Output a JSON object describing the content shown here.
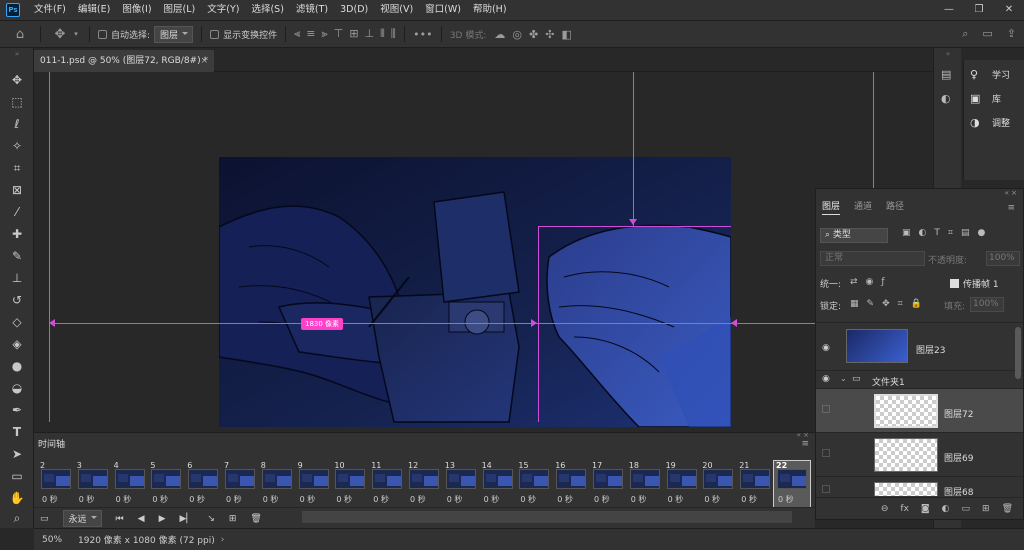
{
  "app": {
    "logo": "Ps"
  },
  "menu": [
    "文件(F)",
    "编辑(E)",
    "图像(I)",
    "图层(L)",
    "文字(Y)",
    "选择(S)",
    "滤镜(T)",
    "3D(D)",
    "视图(V)",
    "窗口(W)",
    "帮助(H)"
  ],
  "window_controls": {
    "minimize": "—",
    "restore": "❐",
    "close": "✕"
  },
  "options": {
    "auto_select_label": "自动选择:",
    "auto_select_value": "图层",
    "show_transform_label": "显示变换控件",
    "more": "•••",
    "mode3d": "3D 模式:"
  },
  "document": {
    "tab_title": "011-1.psd @ 50% (图层72, RGB/8#) *",
    "close": "×"
  },
  "canvas": {
    "measure_label": "1830 像素"
  },
  "right_panel": {
    "learn": "学习",
    "library": "库",
    "adjust": "调整"
  },
  "layers_panel": {
    "tabs": [
      "图层",
      "通道",
      "路径"
    ],
    "filter": "类型",
    "blend_mode": "正常",
    "opacity_label": "不透明度:",
    "opacity_value": "100%",
    "unify_label": "统一:",
    "propagate_label": "传播帧 1",
    "lock_label": "锁定:",
    "fill_label": "填充:",
    "fill_value": "100%",
    "layers": [
      {
        "name": "图层23",
        "type": "gradient",
        "visible": true
      },
      {
        "name": "文件夹1",
        "type": "folder",
        "visible": true
      },
      {
        "name": "图层72",
        "type": "transparent",
        "visible": false,
        "selected": true
      },
      {
        "name": "图层69",
        "type": "transparent",
        "visible": false
      },
      {
        "name": "图层68",
        "type": "transparent",
        "visible": false
      }
    ]
  },
  "timeline": {
    "title": "时间轴",
    "loop": "永远",
    "frames": [
      {
        "num": "2",
        "delay": "0 秒"
      },
      {
        "num": "3",
        "delay": "0 秒"
      },
      {
        "num": "4",
        "delay": "0 秒"
      },
      {
        "num": "5",
        "delay": "0 秒"
      },
      {
        "num": "6",
        "delay": "0 秒"
      },
      {
        "num": "7",
        "delay": "0 秒"
      },
      {
        "num": "8",
        "delay": "0 秒"
      },
      {
        "num": "9",
        "delay": "0 秒"
      },
      {
        "num": "10",
        "delay": "0 秒"
      },
      {
        "num": "11",
        "delay": "0 秒"
      },
      {
        "num": "12",
        "delay": "0 秒"
      },
      {
        "num": "13",
        "delay": "0 秒"
      },
      {
        "num": "14",
        "delay": "0 秒"
      },
      {
        "num": "15",
        "delay": "0 秒"
      },
      {
        "num": "16",
        "delay": "0 秒"
      },
      {
        "num": "17",
        "delay": "0 秒"
      },
      {
        "num": "18",
        "delay": "0 秒"
      },
      {
        "num": "19",
        "delay": "0 秒"
      },
      {
        "num": "20",
        "delay": "0 秒"
      },
      {
        "num": "21",
        "delay": "0 秒"
      },
      {
        "num": "22",
        "delay": "0 秒"
      }
    ]
  },
  "status": {
    "zoom": "50%",
    "doc_info": "1920 像素 x 1080 像素 (72 ppi)"
  },
  "colors": {
    "guide": "#d14cd9",
    "measure": "#ff40c8",
    "panel": "#323232",
    "bg": "#282828"
  }
}
